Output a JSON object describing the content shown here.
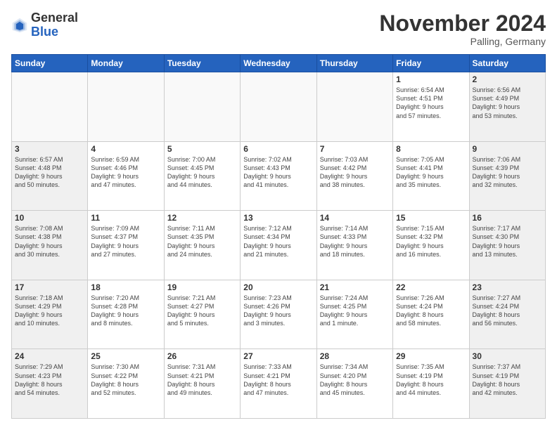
{
  "header": {
    "logo_general": "General",
    "logo_blue": "Blue",
    "month_title": "November 2024",
    "location": "Palling, Germany"
  },
  "days_of_week": [
    "Sunday",
    "Monday",
    "Tuesday",
    "Wednesday",
    "Thursday",
    "Friday",
    "Saturday"
  ],
  "weeks": [
    [
      {
        "day": "",
        "info": ""
      },
      {
        "day": "",
        "info": ""
      },
      {
        "day": "",
        "info": ""
      },
      {
        "day": "",
        "info": ""
      },
      {
        "day": "",
        "info": ""
      },
      {
        "day": "1",
        "info": "Sunrise: 6:54 AM\nSunset: 4:51 PM\nDaylight: 9 hours\nand 57 minutes."
      },
      {
        "day": "2",
        "info": "Sunrise: 6:56 AM\nSunset: 4:49 PM\nDaylight: 9 hours\nand 53 minutes."
      }
    ],
    [
      {
        "day": "3",
        "info": "Sunrise: 6:57 AM\nSunset: 4:48 PM\nDaylight: 9 hours\nand 50 minutes."
      },
      {
        "day": "4",
        "info": "Sunrise: 6:59 AM\nSunset: 4:46 PM\nDaylight: 9 hours\nand 47 minutes."
      },
      {
        "day": "5",
        "info": "Sunrise: 7:00 AM\nSunset: 4:45 PM\nDaylight: 9 hours\nand 44 minutes."
      },
      {
        "day": "6",
        "info": "Sunrise: 7:02 AM\nSunset: 4:43 PM\nDaylight: 9 hours\nand 41 minutes."
      },
      {
        "day": "7",
        "info": "Sunrise: 7:03 AM\nSunset: 4:42 PM\nDaylight: 9 hours\nand 38 minutes."
      },
      {
        "day": "8",
        "info": "Sunrise: 7:05 AM\nSunset: 4:41 PM\nDaylight: 9 hours\nand 35 minutes."
      },
      {
        "day": "9",
        "info": "Sunrise: 7:06 AM\nSunset: 4:39 PM\nDaylight: 9 hours\nand 32 minutes."
      }
    ],
    [
      {
        "day": "10",
        "info": "Sunrise: 7:08 AM\nSunset: 4:38 PM\nDaylight: 9 hours\nand 30 minutes."
      },
      {
        "day": "11",
        "info": "Sunrise: 7:09 AM\nSunset: 4:37 PM\nDaylight: 9 hours\nand 27 minutes."
      },
      {
        "day": "12",
        "info": "Sunrise: 7:11 AM\nSunset: 4:35 PM\nDaylight: 9 hours\nand 24 minutes."
      },
      {
        "day": "13",
        "info": "Sunrise: 7:12 AM\nSunset: 4:34 PM\nDaylight: 9 hours\nand 21 minutes."
      },
      {
        "day": "14",
        "info": "Sunrise: 7:14 AM\nSunset: 4:33 PM\nDaylight: 9 hours\nand 18 minutes."
      },
      {
        "day": "15",
        "info": "Sunrise: 7:15 AM\nSunset: 4:32 PM\nDaylight: 9 hours\nand 16 minutes."
      },
      {
        "day": "16",
        "info": "Sunrise: 7:17 AM\nSunset: 4:30 PM\nDaylight: 9 hours\nand 13 minutes."
      }
    ],
    [
      {
        "day": "17",
        "info": "Sunrise: 7:18 AM\nSunset: 4:29 PM\nDaylight: 9 hours\nand 10 minutes."
      },
      {
        "day": "18",
        "info": "Sunrise: 7:20 AM\nSunset: 4:28 PM\nDaylight: 9 hours\nand 8 minutes."
      },
      {
        "day": "19",
        "info": "Sunrise: 7:21 AM\nSunset: 4:27 PM\nDaylight: 9 hours\nand 5 minutes."
      },
      {
        "day": "20",
        "info": "Sunrise: 7:23 AM\nSunset: 4:26 PM\nDaylight: 9 hours\nand 3 minutes."
      },
      {
        "day": "21",
        "info": "Sunrise: 7:24 AM\nSunset: 4:25 PM\nDaylight: 9 hours\nand 1 minute."
      },
      {
        "day": "22",
        "info": "Sunrise: 7:26 AM\nSunset: 4:24 PM\nDaylight: 8 hours\nand 58 minutes."
      },
      {
        "day": "23",
        "info": "Sunrise: 7:27 AM\nSunset: 4:24 PM\nDaylight: 8 hours\nand 56 minutes."
      }
    ],
    [
      {
        "day": "24",
        "info": "Sunrise: 7:29 AM\nSunset: 4:23 PM\nDaylight: 8 hours\nand 54 minutes."
      },
      {
        "day": "25",
        "info": "Sunrise: 7:30 AM\nSunset: 4:22 PM\nDaylight: 8 hours\nand 52 minutes."
      },
      {
        "day": "26",
        "info": "Sunrise: 7:31 AM\nSunset: 4:21 PM\nDaylight: 8 hours\nand 49 minutes."
      },
      {
        "day": "27",
        "info": "Sunrise: 7:33 AM\nSunset: 4:21 PM\nDaylight: 8 hours\nand 47 minutes."
      },
      {
        "day": "28",
        "info": "Sunrise: 7:34 AM\nSunset: 4:20 PM\nDaylight: 8 hours\nand 45 minutes."
      },
      {
        "day": "29",
        "info": "Sunrise: 7:35 AM\nSunset: 4:19 PM\nDaylight: 8 hours\nand 44 minutes."
      },
      {
        "day": "30",
        "info": "Sunrise: 7:37 AM\nSunset: 4:19 PM\nDaylight: 8 hours\nand 42 minutes."
      }
    ]
  ]
}
